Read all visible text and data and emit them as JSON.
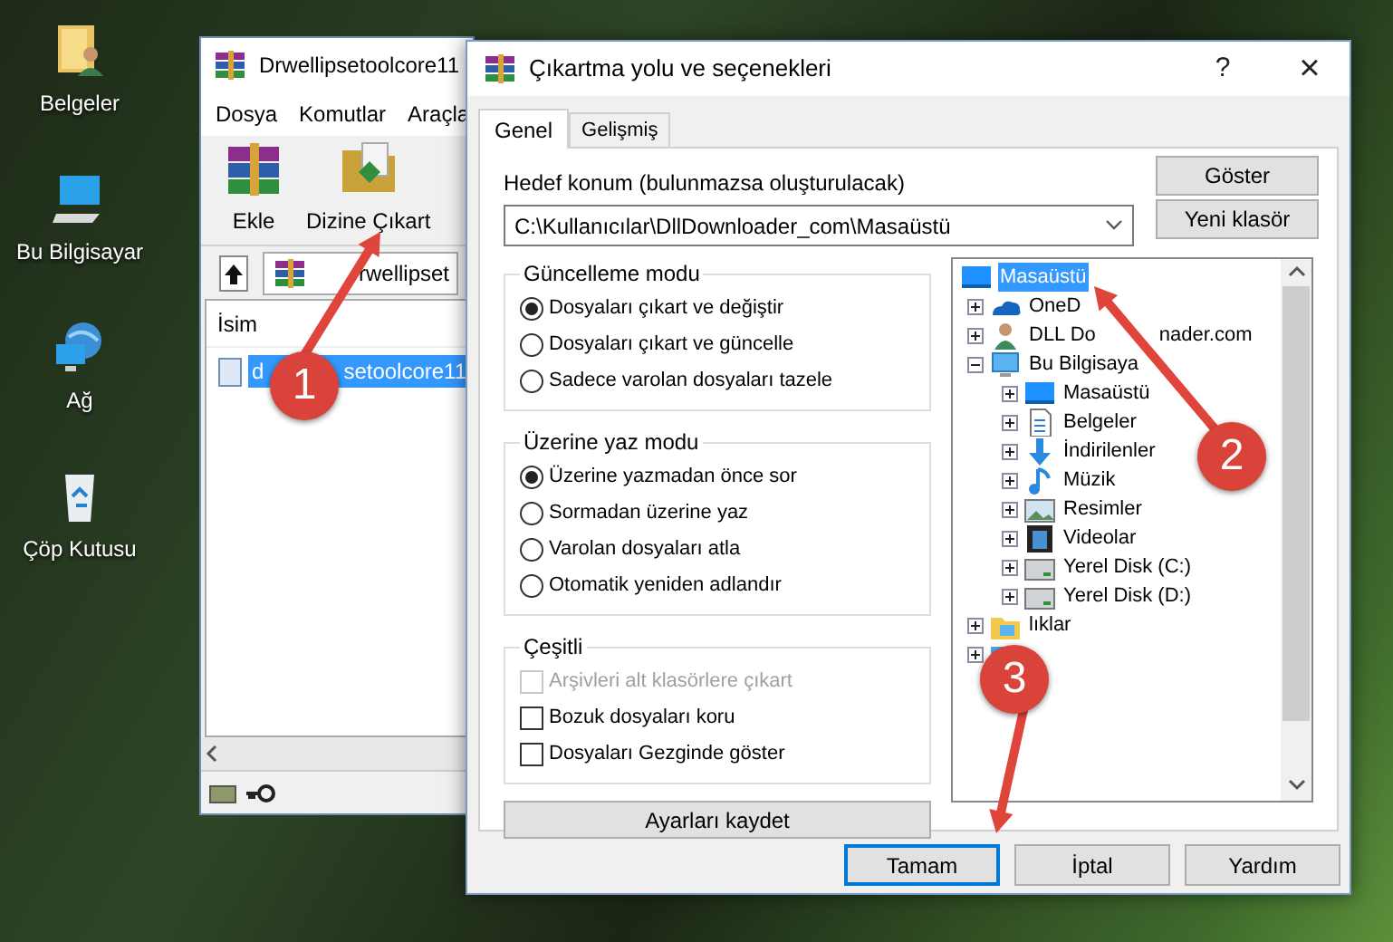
{
  "desktop_icons": [
    {
      "kind": "documents",
      "label": "Belgeler"
    },
    {
      "kind": "computer",
      "label": "Bu Bilgisayar"
    },
    {
      "kind": "network",
      "label": "Ağ"
    },
    {
      "kind": "recycle",
      "label": "Çöp Kutusu"
    }
  ],
  "winrar": {
    "title": "Drwellipsetoolcore11",
    "menu": [
      "Dosya",
      "Komutlar",
      "Araçla"
    ],
    "toolbar": [
      {
        "kind": "add",
        "label": "Ekle"
      },
      {
        "kind": "extract",
        "label": "Dizine Çıkart"
      }
    ],
    "path": "rwellipset",
    "columns": [
      "İsim"
    ],
    "files": [
      {
        "name_parts": [
          "d",
          "setoolcore11"
        ],
        "selected": true
      }
    ]
  },
  "dialog": {
    "title": "Çıkartma yolu ve seçenekleri",
    "help": "?",
    "close": "×",
    "tabs": [
      {
        "label": "Genel",
        "selected": true
      },
      {
        "label": "Gelişmiş",
        "selected": false
      }
    ],
    "destination_label": "Hedef konum (bulunmazsa oluşturulacak)",
    "destination_value": "C:\\Kullanıcılar\\DllDownloader_com\\Masaüstü",
    "side_buttons": [
      "Göster",
      "Yeni klasör"
    ],
    "groups": [
      {
        "title": "Güncelleme modu",
        "options": [
          {
            "kind": "radio",
            "label": "Dosyaları çıkart ve değiştir",
            "selected": true
          },
          {
            "kind": "radio",
            "label": "Dosyaları çıkart ve güncelle",
            "selected": false
          },
          {
            "kind": "radio",
            "label": "Sadece varolan dosyaları tazele",
            "selected": false
          }
        ]
      },
      {
        "title": "Üzerine yaz modu",
        "options": [
          {
            "kind": "radio",
            "label": "Üzerine yazmadan önce sor",
            "selected": true
          },
          {
            "kind": "radio",
            "label": "Sormadan üzerine yaz",
            "selected": false
          },
          {
            "kind": "radio",
            "label": "Varolan dosyaları atla",
            "selected": false
          },
          {
            "kind": "radio",
            "label": "Otomatik yeniden adlandır",
            "selected": false
          }
        ]
      },
      {
        "title": "Çeşitli",
        "options": [
          {
            "kind": "checkbox",
            "label": "Arşivleri alt klasörlere çıkart",
            "checked": false,
            "disabled": true
          },
          {
            "kind": "checkbox",
            "label": "Bozuk dosyaları koru",
            "checked": false,
            "disabled": false
          },
          {
            "kind": "checkbox",
            "label": "Dosyaları Gezginde göster",
            "checked": false,
            "disabled": false
          }
        ]
      }
    ],
    "save_button": "Ayarları kaydet",
    "tree": {
      "kind": "desktop",
      "label": "Masaüstü",
      "selected": true,
      "children": [
        {
          "kind": "cloud",
          "label": "OneD",
          "expanded": false,
          "selected": false
        },
        {
          "kind": "user",
          "label_parts": [
            "DLL Do",
            "nader.com"
          ],
          "expanded": false,
          "selected": false
        },
        {
          "kind": "computer",
          "label": "Bu Bilgisaya",
          "expanded": true,
          "selected": false,
          "children": [
            {
              "kind": "desktop",
              "label": "Masaüstü",
              "expanded": false,
              "selected": false
            },
            {
              "kind": "document",
              "label": "Belgeler",
              "expanded": false,
              "selected": false
            },
            {
              "kind": "download",
              "label": "İndirilenler",
              "expanded": false,
              "selected": false
            },
            {
              "kind": "music",
              "label": "Müzik",
              "expanded": false,
              "selected": false
            },
            {
              "kind": "picture",
              "label": "Resimler",
              "expanded": false,
              "selected": false
            },
            {
              "kind": "video",
              "label": "Videolar",
              "expanded": false,
              "selected": false
            },
            {
              "kind": "disk",
              "label": "Yerel Disk (C:)",
              "expanded": false,
              "selected": false
            },
            {
              "kind": "disk",
              "label": "Yerel Disk (D:)",
              "expanded": false,
              "selected": false
            }
          ]
        },
        {
          "kind": "library",
          "label": "lıklar",
          "expanded": false,
          "selected": false
        },
        {
          "kind": "network",
          "expanded": false
        }
      ]
    },
    "buttons": [
      {
        "label": "Tamam",
        "focused": true
      },
      {
        "label": "İptal",
        "focused": false
      },
      {
        "label": "Yardım",
        "focused": false
      }
    ]
  },
  "callouts": [
    {
      "label": "1"
    },
    {
      "label": "2"
    },
    {
      "label": "3"
    }
  ]
}
